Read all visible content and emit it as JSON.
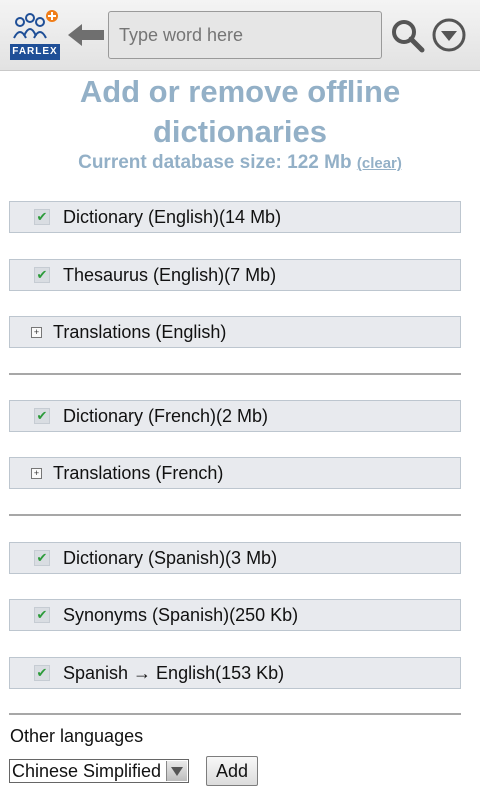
{
  "toolbar": {
    "logo_text": "FARLEX",
    "search_placeholder": "Type word here",
    "back_icon": "back-arrow-icon",
    "search_icon": "search-icon",
    "menu_icon": "menu-dropdown-icon"
  },
  "header": {
    "title_line1": "Add or remove offline",
    "title_line2": "dictionaries",
    "db_label": "Current database size: 122 Mb",
    "clear_link": "(clear)"
  },
  "groups": [
    {
      "items": [
        {
          "label": "Dictionary (English)(14 Mb)",
          "checked": true
        },
        {
          "label": "Thesaurus (English)(7 Mb)",
          "checked": true
        },
        {
          "label": "Translations (English)",
          "expandable": true
        }
      ]
    },
    {
      "items": [
        {
          "label": "Dictionary (French)(2 Mb)",
          "checked": true
        },
        {
          "label": "Translations (French)",
          "expandable": true
        }
      ]
    },
    {
      "items": [
        {
          "label": "Dictionary (Spanish)(3 Mb)",
          "checked": true
        },
        {
          "label": "Synonyms (Spanish)(250 Kb)",
          "checked": true
        },
        {
          "label": "Spanish → English(153 Kb)",
          "checked": true
        }
      ]
    }
  ],
  "footer": {
    "other_languages_label": "Other languages",
    "selected_language": "Chinese Simplified",
    "add_button": "Add"
  },
  "colors": {
    "heading": "#93b0c7",
    "row_bg": "#e8eaee",
    "check": "#2c9b3a"
  }
}
